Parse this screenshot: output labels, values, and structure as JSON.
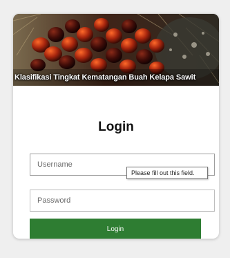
{
  "banner": {
    "title": "Klasifikasi Tingkat Kematangan Buah Kelapa Sawit"
  },
  "login": {
    "heading": "Login",
    "username_placeholder": "Username",
    "username_value": "",
    "password_placeholder": "Password",
    "password_value": "",
    "submit_label": "Login",
    "validation_tooltip": "Please fill out this field."
  },
  "colors": {
    "button": "#2e7d32",
    "page_background": "#efefef"
  }
}
